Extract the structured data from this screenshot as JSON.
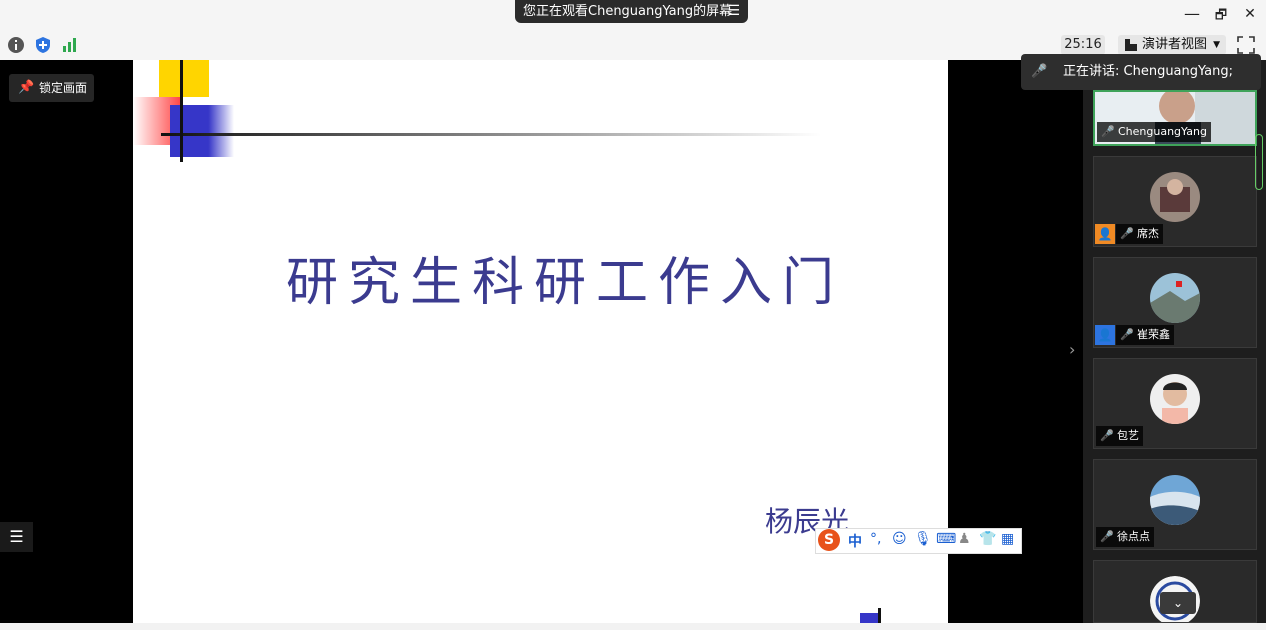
{
  "window": {
    "banner_text": "您正在观看ChenguangYang的屏幕",
    "minimize": "—",
    "restore": "🗗",
    "close": "✕"
  },
  "toolbar": {
    "timer": "25:16",
    "view_label": "演讲者视图"
  },
  "stage": {
    "lock_label": "锁定画面"
  },
  "slide": {
    "title": "研究生科研工作入门",
    "author": "杨辰光"
  },
  "speaking": {
    "text": "正在讲话: ChenguangYang;"
  },
  "participants": [
    {
      "name": "ChenguangYang"
    },
    {
      "name": "席杰"
    },
    {
      "name": "崔荣鑫"
    },
    {
      "name": "包艺"
    },
    {
      "name": "徐点点"
    }
  ],
  "ime": {
    "lang": "中"
  },
  "colors": {
    "accent_green": "#3fa35a",
    "slide_text": "#3b3b8f"
  }
}
